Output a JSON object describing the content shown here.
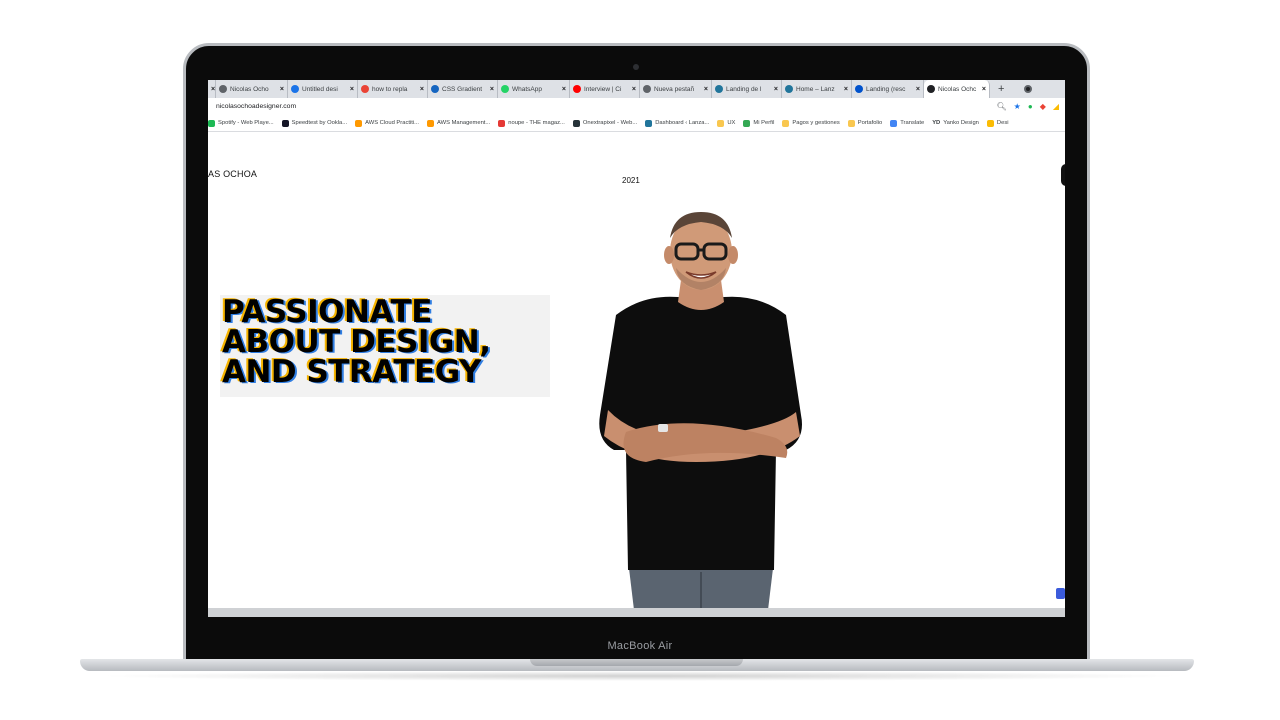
{
  "device": {
    "model_label": "MacBook Air"
  },
  "browser": {
    "tabs": [
      {
        "title": "Nicolas Ocho",
        "favicon": "wordpress-icon",
        "color": "#5f6368"
      },
      {
        "title": "Untitled desi",
        "favicon": "canva-icon",
        "color": "#1a73e8"
      },
      {
        "title": "how to repla",
        "favicon": "google-icon",
        "color": "#ea4335"
      },
      {
        "title": "CSS Gradient",
        "favicon": "css-gradient-icon",
        "color": "#1565c0"
      },
      {
        "title": "WhatsApp",
        "favicon": "whatsapp-icon",
        "color": "#25d366"
      },
      {
        "title": "Interview | Ci",
        "favicon": "youtube-icon",
        "color": "#ff0000"
      },
      {
        "title": "Nueva pestañ",
        "favicon": "chrome-icon",
        "color": "#5f6368"
      },
      {
        "title": "Landing de l",
        "favicon": "wordpress-icon",
        "color": "#21759b"
      },
      {
        "title": "Home – Lanz",
        "favicon": "wordpress-icon",
        "color": "#21759b"
      },
      {
        "title": "Landing (resc",
        "favicon": "trello-icon",
        "color": "#0052cc"
      },
      {
        "title": "Nicolas Ochc",
        "favicon": "person-icon",
        "color": "#202124",
        "active": true
      }
    ],
    "new_tab_symbol": "+",
    "close_symbol": "×",
    "url": "nicolasochoadesigner.com",
    "bookmarks": [
      {
        "label": "Spotify - Web Playe...",
        "color": "#1db954"
      },
      {
        "label": "Speedtest by Ookla...",
        "color": "#141526"
      },
      {
        "label": "AWS Cloud Practiti...",
        "color": "#ff9900"
      },
      {
        "label": "AWS Management...",
        "color": "#ff9900"
      },
      {
        "label": "noupe - THE magaz...",
        "color": "#e53935"
      },
      {
        "label": "Onextrapixel - Web...",
        "color": "#263238"
      },
      {
        "label": "Dashboard ‹ Lanza...",
        "color": "#21759b"
      },
      {
        "label": "UX",
        "color": "#f9c74f"
      },
      {
        "label": "Mi Perfil",
        "color": "#34a853"
      },
      {
        "label": "Pagos y gestiones",
        "color": "#f9c74f"
      },
      {
        "label": "Portafolio",
        "color": "#f9c74f"
      },
      {
        "label": "Translate",
        "color": "#4285f4"
      },
      {
        "label": "Yanko Design",
        "color": "#000000",
        "prefix": "YD"
      },
      {
        "label": "Desi",
        "color": "#fbbc04"
      }
    ]
  },
  "site": {
    "logo_text": "AS OCHOA",
    "year": "2021",
    "headline_lines": [
      "PASSIONATE",
      "ABOUT DESIGN,",
      "AND STRATEGY"
    ],
    "accent_colors": {
      "yellow": "#f6b400",
      "blue": "#2f7de1"
    }
  }
}
